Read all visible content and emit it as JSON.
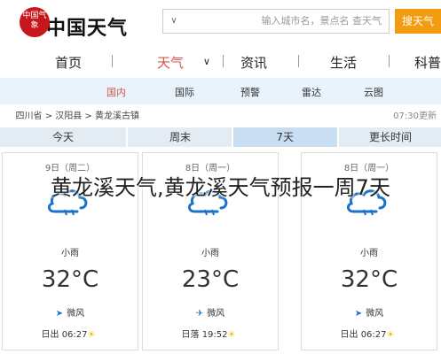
{
  "header": {
    "logo_text": "中国天气",
    "logo_seal": "中国气象",
    "search_placeholder": "输入城市名，景点名 查天气",
    "search_dropdown": "∨",
    "search_button": "搜天气"
  },
  "nav": {
    "items": [
      "首页",
      "天气",
      "资讯",
      "生活",
      "科普"
    ],
    "active": "天气",
    "chevron": "∨"
  },
  "subnav": {
    "items": [
      "国内",
      "国际",
      "预警",
      "雷达",
      "云图"
    ],
    "active": "国内"
  },
  "breadcrumb": {
    "path": "四川省 > 汉阳县 > 黄龙溪古镇",
    "updated": "07:30更新"
  },
  "tabs": {
    "items": [
      "今天",
      "周末",
      "7天",
      "更长时间"
    ],
    "active": "7天"
  },
  "forecast": [
    {
      "date": "9日（周二）",
      "condition": "小雨",
      "temp": "32°C",
      "wind": "微风",
      "wind_icon": "arrow-down-icon",
      "sun": "日出 06:27"
    },
    {
      "date": "8日（周一）",
      "condition": "小雨",
      "temp": "23°C",
      "wind": "微风",
      "wind_icon": "arrow-left-icon",
      "sun": "日落 19:52"
    },
    {
      "date": "8日（周一）",
      "condition": "小雨",
      "temp": "32°C",
      "wind": "微风",
      "wind_icon": "arrow-left-icon",
      "sun": "日出 06:27"
    }
  ],
  "overlay_title": "黄龙溪天气,黄龙溪天气预报一周7天",
  "colors": {
    "accent": "#f39c12",
    "active": "#d9534f",
    "rain": "#1a73c9"
  }
}
